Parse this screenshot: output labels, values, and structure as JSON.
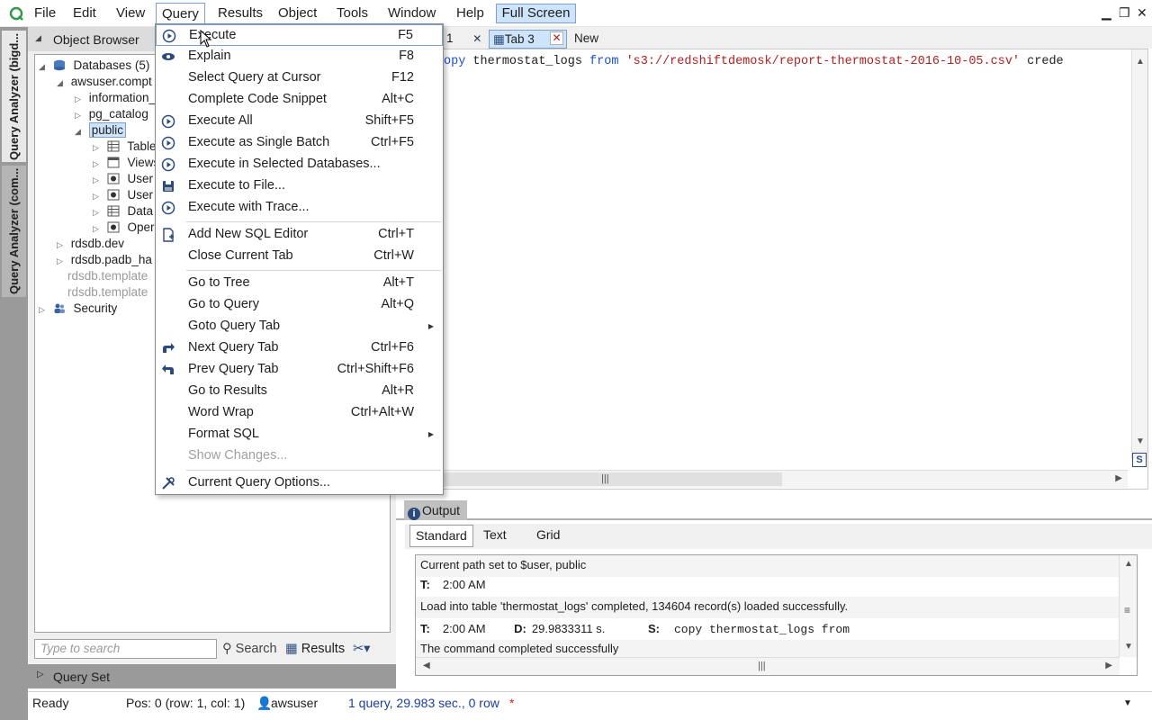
{
  "menubar": {
    "items": [
      "File",
      "Edit",
      "View",
      "Query",
      "Results",
      "Object",
      "Tools",
      "Window",
      "Help"
    ],
    "active": "Query",
    "full_screen": "Full Screen"
  },
  "left_rail": {
    "tabs": [
      "Query Analyzer (bigd...",
      "Query Analyzer (com..."
    ]
  },
  "object_browser": {
    "title": "Object Browser",
    "tree": [
      {
        "label": "Databases (5)"
      },
      {
        "label": "awsuser.compt"
      },
      {
        "label": "information_"
      },
      {
        "label": "pg_catalog"
      },
      {
        "label": "public"
      },
      {
        "label": "Table"
      },
      {
        "label": "Views"
      },
      {
        "label": "User"
      },
      {
        "label": "User"
      },
      {
        "label": "Data"
      },
      {
        "label": "Oper"
      },
      {
        "label": "rdsdb.dev"
      },
      {
        "label": "rdsdb.padb_ha"
      },
      {
        "label": "rdsdb.template"
      },
      {
        "label": "rdsdb.template"
      },
      {
        "label": "Security"
      }
    ],
    "search_placeholder": "Type to search",
    "search_label": "Search",
    "results_label": "Results",
    "query_set": "Query Set"
  },
  "query_menu": {
    "items": [
      {
        "label": "Execute",
        "shortcut": "F5",
        "icon": "execute-icon"
      },
      {
        "label": "Explain",
        "shortcut": "F8",
        "icon": "eye-icon"
      },
      {
        "label": "Select Query at Cursor",
        "shortcut": "F12"
      },
      {
        "label": "Complete Code Snippet",
        "shortcut": "Alt+C"
      },
      {
        "label": "Execute All",
        "shortcut": "Shift+F5",
        "icon": "execute-icon"
      },
      {
        "label": "Execute as Single Batch",
        "shortcut": "Ctrl+F5",
        "icon": "execute-icon"
      },
      {
        "label": "Execute in Selected Databases...",
        "shortcut": "",
        "icon": "execute-icon"
      },
      {
        "label": "Execute to File...",
        "shortcut": "",
        "icon": "save-icon"
      },
      {
        "label": "Execute with Trace...",
        "shortcut": "",
        "icon": "execute-icon"
      },
      {
        "label": "Add New SQL Editor",
        "shortcut": "Ctrl+T",
        "icon": "new-document-icon"
      },
      {
        "label": "Close Current Tab",
        "shortcut": "Ctrl+W"
      },
      {
        "label": "Go to Tree",
        "shortcut": "Alt+T"
      },
      {
        "label": "Go to Query",
        "shortcut": "Alt+Q"
      },
      {
        "label": "Goto Query Tab",
        "shortcut": ""
      },
      {
        "label": "Next Query Tab",
        "shortcut": "Ctrl+F6",
        "icon": "arrow-forward-icon"
      },
      {
        "label": "Prev Query Tab",
        "shortcut": "Ctrl+Shift+F6",
        "icon": "arrow-back-icon"
      },
      {
        "label": "Go to Results",
        "shortcut": "Alt+R"
      },
      {
        "label": "Word Wrap",
        "shortcut": "Ctrl+Alt+W"
      },
      {
        "label": "Format SQL",
        "shortcut": ""
      },
      {
        "label": "Show Changes...",
        "shortcut": ""
      },
      {
        "label": "Current Query Options...",
        "shortcut": "",
        "icon": "tools-icon"
      }
    ]
  },
  "editor": {
    "tabs": [
      "1",
      "Tab 3",
      "New"
    ],
    "active_tab": "Tab 3",
    "code": {
      "kw": "opy",
      "plain": " thermostat_logs ",
      "kw2": "from",
      "sp": " ",
      "str": "'s3://redshiftdemosk/report-thermostat-2016-10-05.csv'",
      "tail": " crede"
    }
  },
  "output": {
    "tab": "Output",
    "subtabs": [
      "Standard",
      "Text",
      "Grid"
    ],
    "active_subtab": "Standard",
    "rows": [
      {
        "text": "Current path set to $user, public"
      },
      {
        "t_label": "T:",
        "t_value": "2:00 AM"
      },
      {
        "text": "Load into table 'thermostat_logs' completed, 134604 record(s) loaded successfully."
      },
      {
        "t_label": "T:",
        "t_value": "2:00 AM",
        "d_label": "D:",
        "d_value": "29.9833311 s.",
        "s_label": "S:",
        "s_value": "copy thermostat_logs from"
      },
      {
        "text": "The command completed successfully"
      }
    ]
  },
  "statusbar": {
    "ready": "Ready",
    "pos": "Pos: 0 (row: 1, col: 1)",
    "user": "awsuser",
    "summary": "1 query, 29.983 sec., 0 row",
    "modified": "*"
  },
  "colors": {
    "accent": "#cde4fb",
    "accent_border": "#7da2ce",
    "keyword": "#1a4fd8",
    "string": "#b01f1f",
    "status_link": "#1a3fa0",
    "modified": "#d02020"
  }
}
